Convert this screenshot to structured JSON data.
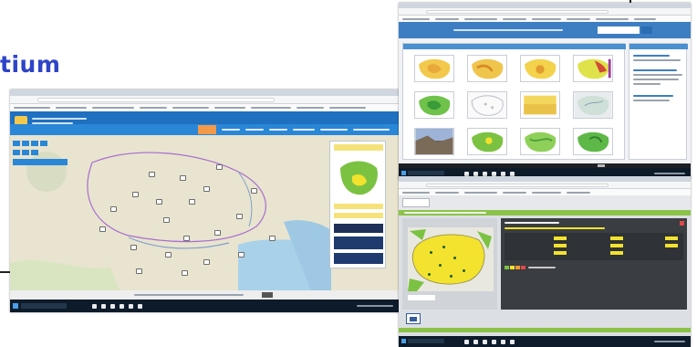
{
  "heading": {
    "text": "tium"
  },
  "colors": {
    "heading": "#2e44c8",
    "header_blue": "#1f70c1",
    "portal_blue": "#3d7ec2",
    "meteo_yellow": "#f3e22e",
    "meteo_green": "#7cc242",
    "map_sea": "#a9d1ea",
    "map_land": "#e6e3cf",
    "panel_dark": "#3a3d42"
  },
  "shots": [
    {
      "name": "weather-station-map",
      "icons": [
        "station-marker-icon",
        "legend-map-icon",
        "meteoalarm-logo"
      ]
    },
    {
      "name": "map-gallery-portal",
      "icons": [
        "map-thumbnail",
        "news-panel"
      ]
    },
    {
      "name": "meteo-warnings-page",
      "icons": [
        "warning-map",
        "warning-table",
        "meteoalarm-logo"
      ]
    }
  ]
}
